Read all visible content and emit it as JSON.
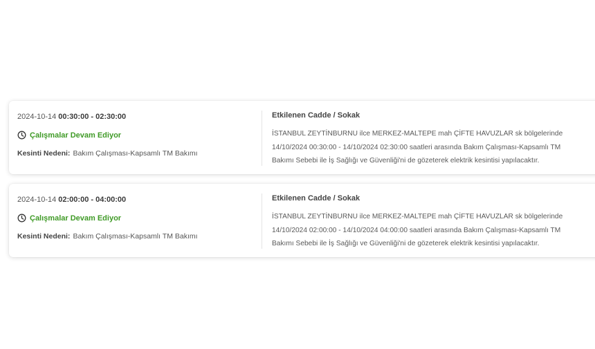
{
  "colors": {
    "status_green": "#3f9a26",
    "text_dark": "#3a3a3a",
    "text_muted": "#555555",
    "card_bg": "#ffffff"
  },
  "outages": [
    {
      "date": "2024-10-14",
      "time_range": "00:30:00 - 02:30:00",
      "status_icon": "clock-icon",
      "status": "Çalışmalar Devam Ediyor",
      "reason_label": "Kesinti Nedeni:",
      "reason": "Bakım Çalışması-Kapsamlı TM Bakımı",
      "affected_heading": "Etkilenen Cadde / Sokak",
      "affected_text": "İSTANBUL ZEYTİNBURNU ilce MERKEZ-MALTEPE mah ÇİFTE HAVUZLAR sk bölgelerinde 14/10/2024 00:30:00 - 14/10/2024 02:30:00 saatleri arasında Bakım Çalışması-Kapsamlı TM Bakımı Sebebi ile İş Sağlığı ve Güvenliği'ni de gözeterek elektrik kesintisi yapılacaktır."
    },
    {
      "date": "2024-10-14",
      "time_range": "02:00:00 - 04:00:00",
      "status_icon": "clock-icon",
      "status": "Çalışmalar Devam Ediyor",
      "reason_label": "Kesinti Nedeni:",
      "reason": "Bakım Çalışması-Kapsamlı TM Bakımı",
      "affected_heading": "Etkilenen Cadde / Sokak",
      "affected_text": "İSTANBUL ZEYTİNBURNU ilce MERKEZ-MALTEPE mah ÇİFTE HAVUZLAR sk bölgelerinde 14/10/2024 02:00:00 - 14/10/2024 04:00:00 saatleri arasında Bakım Çalışması-Kapsamlı TM Bakımı Sebebi ile İş Sağlığı ve Güvenliği'ni de gözeterek elektrik kesintisi yapılacaktır."
    }
  ]
}
